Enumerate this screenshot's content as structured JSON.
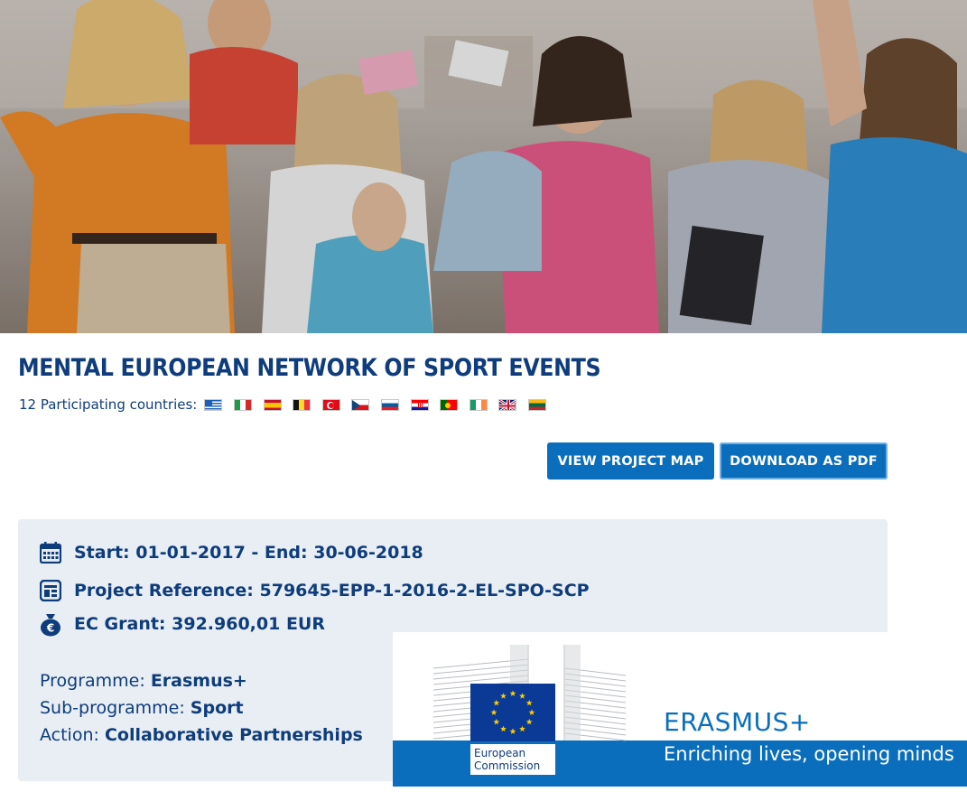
{
  "project": {
    "title": "MENTAL EUROPEAN NETWORK OF SPORT EVENTS",
    "countries_label": "12 Participating countries:",
    "flags": [
      {
        "name": "greece-flag-icon"
      },
      {
        "name": "italy-flag-icon"
      },
      {
        "name": "spain-flag-icon"
      },
      {
        "name": "belgium-flag-icon"
      },
      {
        "name": "turkey-flag-icon"
      },
      {
        "name": "czech-republic-flag-icon"
      },
      {
        "name": "slovenia-flag-icon"
      },
      {
        "name": "croatia-flag-icon"
      },
      {
        "name": "portugal-flag-icon"
      },
      {
        "name": "ireland-flag-icon"
      },
      {
        "name": "united-kingdom-flag-icon"
      },
      {
        "name": "lithuania-flag-icon"
      }
    ]
  },
  "buttons": {
    "view_map": "VIEW PROJECT MAP",
    "download_pdf": "DOWNLOAD AS PDF"
  },
  "info": {
    "dates": "Start: 01-01-2017 - End: 30-06-2018",
    "reference": "Project Reference: 579645-EPP-1-2016-2-EL-SPO-SCP",
    "grant": "EC Grant: 392.960,01 EUR",
    "programme_label": "Programme:",
    "programme_value": "Erasmus+",
    "subprogramme_label": "Sub-programme:",
    "subprogramme_value": "Sport",
    "action_label": "Action:",
    "action_value": "Collaborative Partnerships"
  },
  "banner": {
    "ec_label_line1": "European",
    "ec_label_line2": "Commission",
    "programme_name": "ERASMUS+",
    "tagline": "Enriching lives, opening minds"
  },
  "icons": {
    "calendar": "calendar-icon",
    "reference": "document-icon",
    "grant": "euro-moneybag-icon"
  },
  "colors": {
    "brand_dark": "#0e3c7c",
    "brand_blue": "#0a6ebd",
    "info_bg": "#e8eef4",
    "eu_yellow": "#ffcc00"
  }
}
